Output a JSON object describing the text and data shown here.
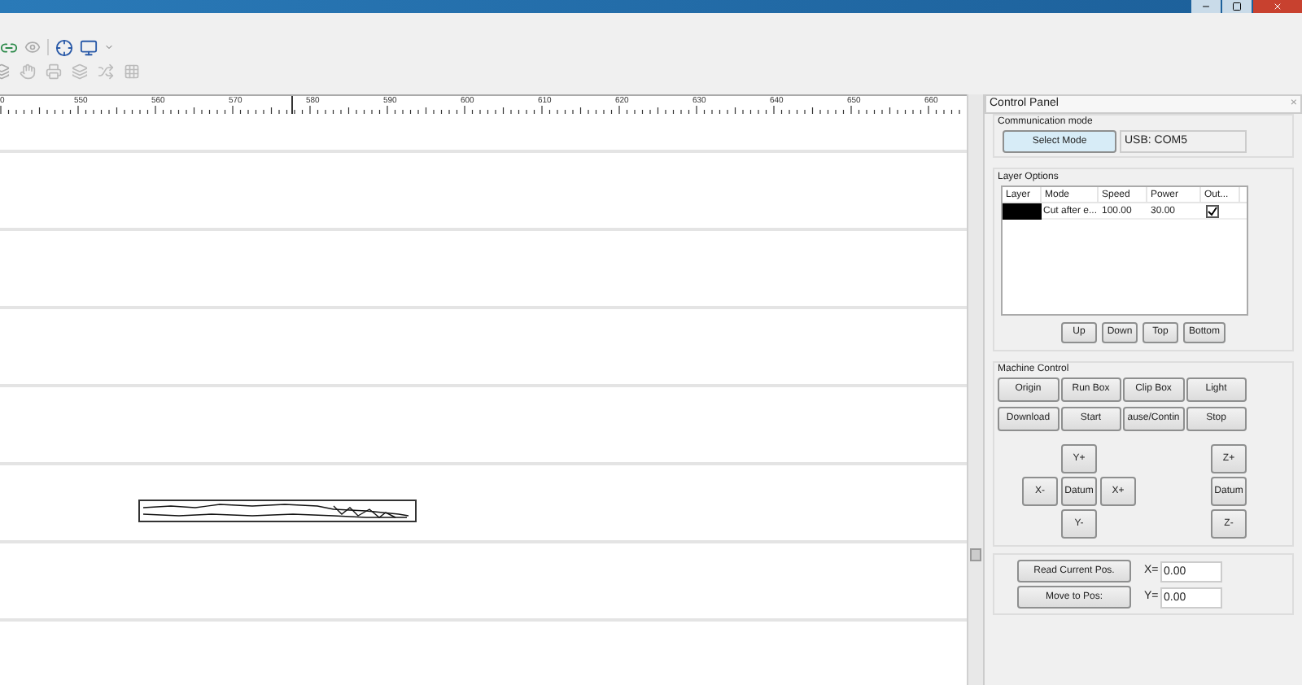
{
  "ruler": {
    "labels": [
      "0",
      "550",
      "560",
      "570",
      "580",
      "590",
      "600",
      "610",
      "620",
      "630",
      "640",
      "650",
      "660"
    ]
  },
  "control_panel": {
    "title": "Control Panel",
    "close": "×",
    "communication": {
      "label": "Communication mode",
      "button": "Select Mode",
      "port": "USB: COM5"
    },
    "layer_options": {
      "label": "Layer Options",
      "columns": [
        "Layer",
        "Mode",
        "Speed",
        "Power",
        "Out..."
      ],
      "rows": [
        {
          "color": "#000000",
          "mode": "Cut after e...",
          "speed": "100.00",
          "power": "30.00",
          "checked": true
        }
      ],
      "buttons": [
        "Up",
        "Down",
        "Top",
        "Bottom"
      ]
    },
    "machine_control": {
      "label": "Machine Control",
      "buttons": [
        "Origin",
        "Run Box",
        "Clip Box",
        "Light",
        "Download",
        "Start",
        "ause/Contin",
        "Stop"
      ],
      "jog": {
        "y_plus": "Y+",
        "x_minus": "X-",
        "datum": "Datum",
        "x_plus": "X+",
        "y_minus": "Y-",
        "z_plus": "Z+",
        "z_datum": "Datum",
        "z_minus": "Z-"
      }
    },
    "position": {
      "read_button": "Read Current Pos.",
      "move_button": "Move to Pos:",
      "x_label": "X=",
      "x_value": "0.00",
      "y_label": "Y=",
      "y_value": "0.00"
    }
  }
}
